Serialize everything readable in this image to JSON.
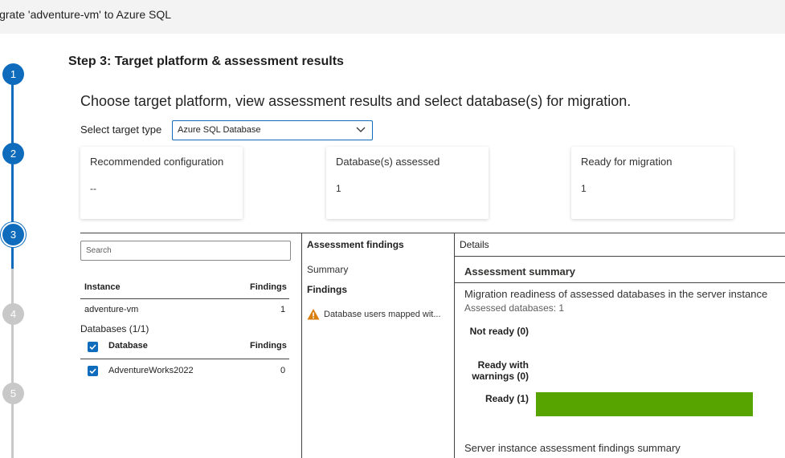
{
  "window": {
    "title": "igrate 'adventure-vm' to Azure SQL"
  },
  "stepper": {
    "steps": [
      "1",
      "2",
      "3",
      "4",
      "5"
    ]
  },
  "page": {
    "step_title": "Step 3: Target platform & assessment results",
    "heading": "Choose target platform, view assessment results and select database(s) for migration.",
    "target_type_label": "Select target type",
    "target_type_value": "Azure SQL Database"
  },
  "cards": [
    {
      "label": "Recommended configuration",
      "value": "--"
    },
    {
      "label": "Database(s) assessed",
      "value": "1"
    },
    {
      "label": "Ready for migration",
      "value": "1"
    }
  ],
  "left_panel": {
    "search_placeholder": "Search",
    "instance_header": "Instance",
    "findings_header": "Findings",
    "instance_row": {
      "name": "adventure-vm",
      "findings": "1"
    },
    "databases_heading": "Databases (1/1)",
    "database_header": "Database",
    "database_findings_header": "Findings",
    "database_row": {
      "name": "AdventureWorks2022",
      "findings": "0",
      "checked": true
    }
  },
  "mid_panel": {
    "title": "Assessment findings",
    "summary": "Summary",
    "findings": "Findings",
    "finding_item": "Database users mapped wit..."
  },
  "right_panel": {
    "title": "Details",
    "subtitle": "Assessment summary",
    "description": "Migration readiness of assessed databases in the server instance",
    "assessed": "Assessed databases: 1",
    "bars": [
      {
        "label_line1": "Not ready (0)",
        "label_line2": "",
        "value": 0
      },
      {
        "label_line1": "Ready with",
        "label_line2": "warnings (0)",
        "value": 0
      },
      {
        "label_line1": "Ready (1)",
        "label_line2": "",
        "value": 1
      }
    ],
    "bar_max": 1,
    "bar_color": "#57a300",
    "bottom_text": "Server instance assessment findings summary"
  },
  "colors": {
    "accent": "#0f6cbd",
    "warning": "#d97d0b",
    "inactive_step": "#c8c8c8"
  }
}
